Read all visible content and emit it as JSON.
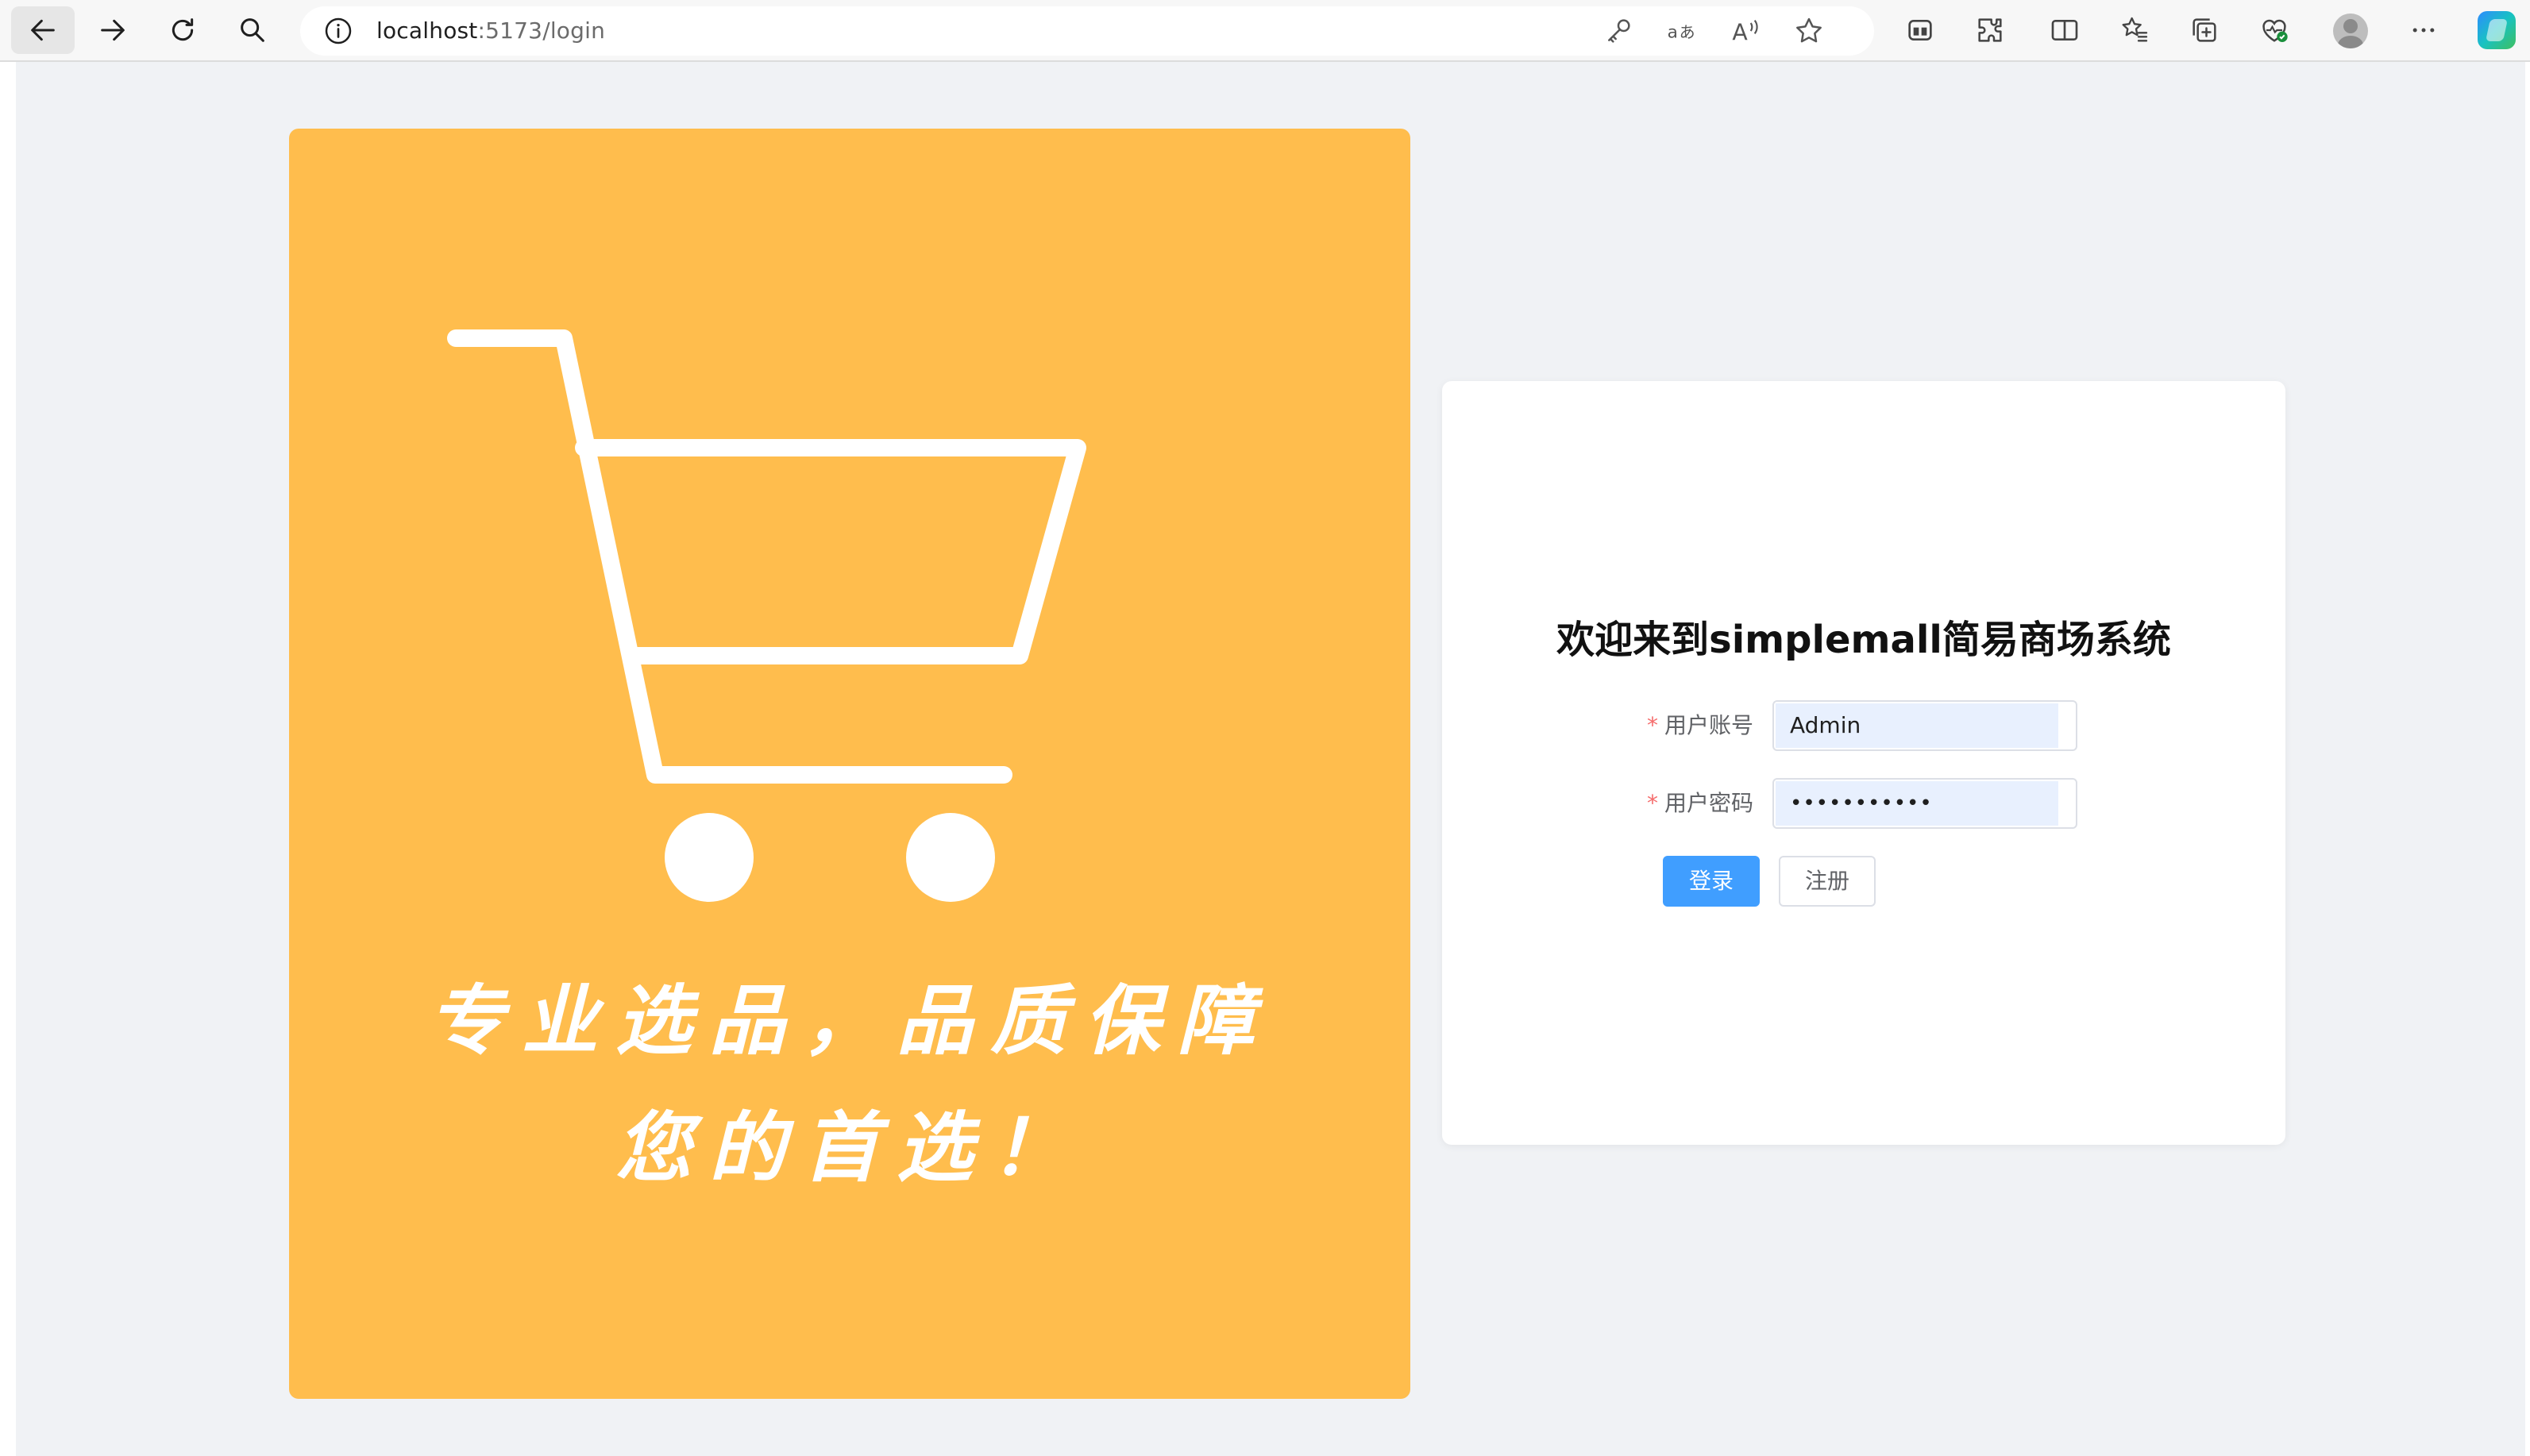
{
  "browser": {
    "url_host": "localhost",
    "url_path": ":5173/login",
    "icons": [
      "back-icon",
      "forward-icon",
      "refresh-icon",
      "search-icon",
      "site-info-icon",
      "key-icon",
      "translate-icon",
      "read-aloud-icon",
      "favorite-star-icon",
      "workspaces-icon",
      "extensions-icon",
      "split-screen-icon",
      "favorites-icon",
      "collections-icon",
      "browser-essentials-icon",
      "profile-avatar",
      "more-icon",
      "copilot-icon"
    ]
  },
  "banner": {
    "slogan_line1": "专业选品，品质保障",
    "slogan_line2": "您的首选！",
    "background": "#ffbd4d"
  },
  "login": {
    "title": "欢迎来到simplemall简易商场系统",
    "username_label": "用户账号",
    "username_value": "Admin",
    "password_label": "用户密码",
    "password_value": "•••••••••••",
    "required_mark": "*",
    "login_button": "登录",
    "register_button": "注册"
  },
  "colors": {
    "primary": "#409eff",
    "required": "#f56c6c",
    "page_bg": "#f0f2f5",
    "autofill": "#e8f0fe"
  }
}
